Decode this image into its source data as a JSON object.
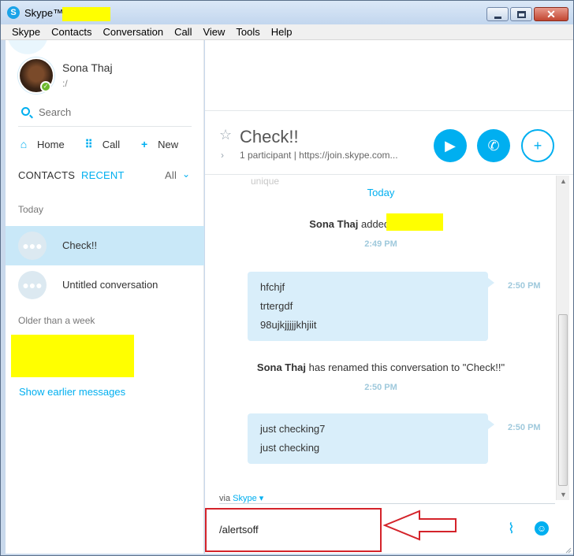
{
  "window": {
    "title": "Skype™ - ",
    "app_icon": "skype-logo-icon"
  },
  "menu": [
    "Skype",
    "Contacts",
    "Conversation",
    "Call",
    "View",
    "Tools",
    "Help"
  ],
  "profile": {
    "name": "Sona Thaj",
    "mood": ":/"
  },
  "search": {
    "placeholder": "Search"
  },
  "nav": {
    "home": "Home",
    "call": "Call",
    "new": "New"
  },
  "tabs": {
    "contacts": "CONTACTS",
    "recent": "RECENT",
    "all": "All"
  },
  "sections": {
    "today": "Today",
    "older": "Older than a week"
  },
  "conversations": [
    {
      "label": "Check!!",
      "active": true
    },
    {
      "label": "Untitled conversation",
      "active": false
    }
  ],
  "show_earlier": "Show earlier messages",
  "conversation": {
    "title": "Check!!",
    "meta": "1 participant  |  https://join.skype.com..."
  },
  "chat": {
    "faded_text": "unique",
    "day": "Today",
    "added_prefix_name": "Sona Thaj",
    "added_text": "added",
    "added_time": "2:49 PM",
    "bubble1": [
      "hfchjf",
      "trtergdf",
      "98ujkjjjjjkhjiit"
    ],
    "bubble1_time": "2:50 PM",
    "rename_name": "Sona Thaj",
    "rename_text": "has renamed this conversation to \"Check!!\"",
    "rename_time": "2:50 PM",
    "bubble2": [
      "just checking7",
      "just checking"
    ],
    "bubble2_time": "2:50 PM"
  },
  "compose": {
    "via_label": "via",
    "via_service": "Skype",
    "text": "/alertsoff"
  },
  "colors": {
    "accent": "#00aff0",
    "highlight_border": "#d4232a",
    "active_row": "#c9e8f8",
    "bubble": "#d9eefa",
    "redaction": "#ffff00"
  }
}
